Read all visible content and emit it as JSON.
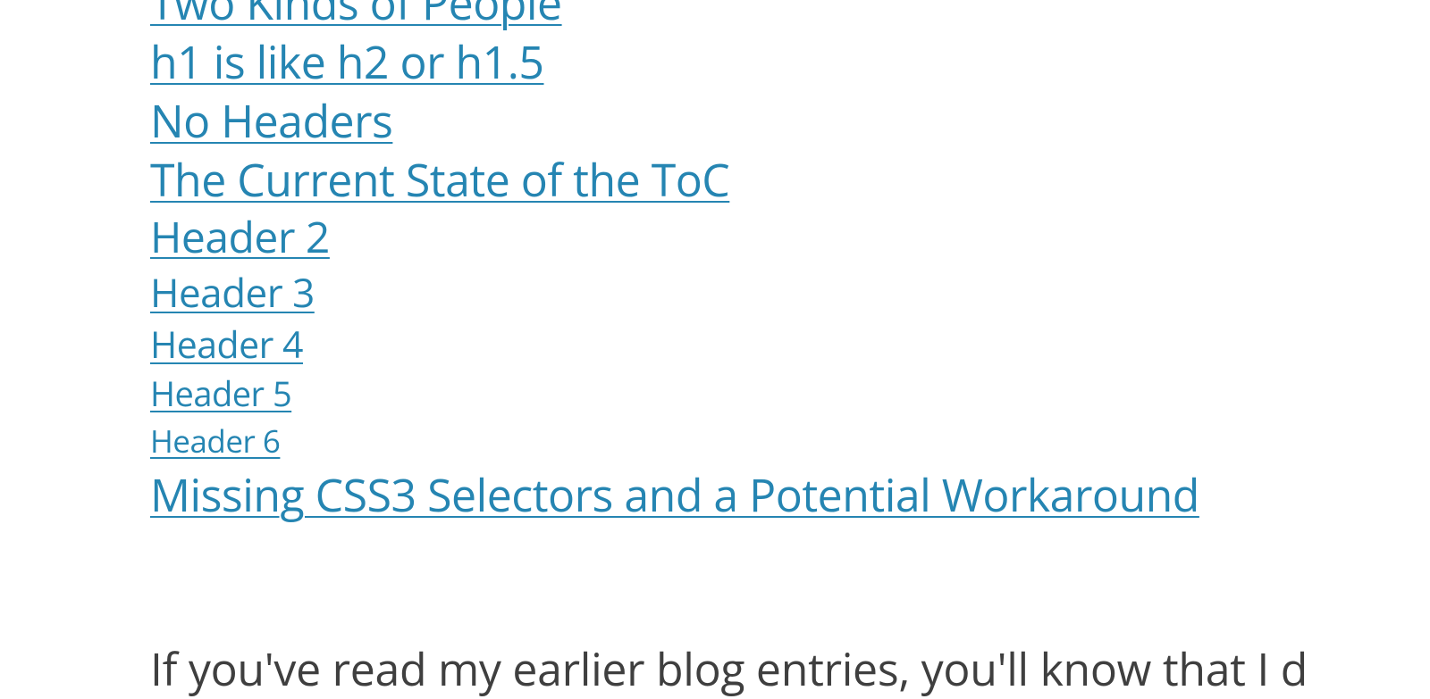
{
  "toc": {
    "items": [
      {
        "label": "Two Kinds of People",
        "sizeClass": "size-0"
      },
      {
        "label": "h1 is like h2 or h1.5",
        "sizeClass": "size-1"
      },
      {
        "label": "No Headers",
        "sizeClass": "size-2"
      },
      {
        "label": "The Current State of the ToC",
        "sizeClass": "size-2"
      },
      {
        "label": "Header 2",
        "sizeClass": "size-3"
      },
      {
        "label": "Header 3",
        "sizeClass": "size-4"
      },
      {
        "label": "Header 4",
        "sizeClass": "size-5"
      },
      {
        "label": "Header 5",
        "sizeClass": "size-6"
      },
      {
        "label": "Header 6",
        "sizeClass": "size-7"
      },
      {
        "label": "Missing CSS3 Selectors and a Potential Workaround",
        "sizeClass": "size-8"
      }
    ]
  },
  "body": {
    "intro": "If you've read my earlier blog entries, you'll know that I d"
  },
  "colors": {
    "link": "#2585b2",
    "text": "#3f3f3f",
    "background": "#ffffff"
  }
}
